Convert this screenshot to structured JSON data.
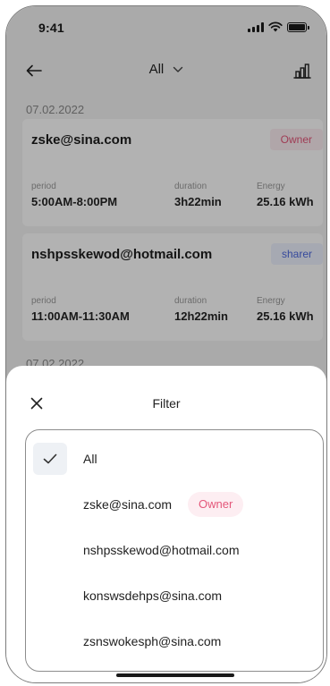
{
  "status_bar": {
    "time": "9:41"
  },
  "nav": {
    "title": "All"
  },
  "records": [
    {
      "date": "07.02.2022",
      "user": "zske@sina.com",
      "role": "Owner",
      "period_label": "period",
      "period": "5:00AM-8:00PM",
      "duration_label": "duration",
      "duration": "3h22min",
      "energy_label": "Energy",
      "energy": "25.16 kWh"
    },
    {
      "user": "nshpsskewod@hotmail.com",
      "role": "sharer",
      "period_label": "period",
      "period": "11:00AM-11:30AM",
      "duration_label": "duration",
      "duration": "12h22min",
      "energy_label": "Energy",
      "energy": "25.16 kWh"
    }
  ],
  "next_date": "07.02.2022",
  "filter": {
    "title": "Filter",
    "options": [
      {
        "label": "All",
        "selected": true
      },
      {
        "label": "zske@sina.com",
        "tag": "Owner"
      },
      {
        "label": "nshpsskewod@hotmail.com"
      },
      {
        "label": "konswsdehps@sina.com"
      },
      {
        "label": "zsnswokesph@sina.com"
      }
    ]
  },
  "colors": {
    "owner_tag_bg": "#fdeef2",
    "owner_tag_text": "#e4577a",
    "sharer_tag_bg": "#eef2ff",
    "sharer_tag_text": "#4e6ae0",
    "overlay": "rgba(0,0,0,0.30)"
  },
  "icons": {
    "back": "arrow-left-icon",
    "title_dropdown": "chevron-down-icon",
    "statistics": "bar-chart-icon",
    "close": "close-icon",
    "selected": "check-icon"
  }
}
